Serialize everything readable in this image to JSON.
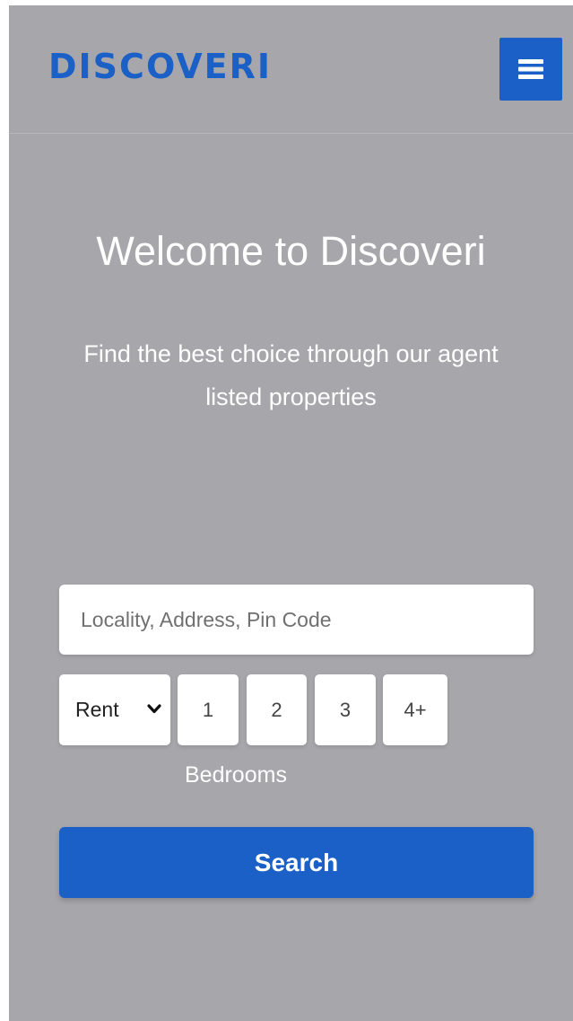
{
  "header": {
    "logo_text": "DISCOVERI",
    "menu_icon": "hamburger-menu-icon"
  },
  "hero": {
    "title": "Welcome to Discoveri",
    "subtitle_line1": "Find the best choice through our agent",
    "subtitle_line2": "listed properties"
  },
  "search": {
    "placeholder": "Locality, Address, Pin Code",
    "value": "",
    "listing_type": {
      "selected": "Rent",
      "icon": "chevron-down-icon"
    },
    "bedroom_options": [
      "1",
      "2",
      "3",
      "4+"
    ],
    "bedrooms_label": "Bedrooms",
    "submit_label": "Search"
  },
  "colors": {
    "brand_blue": "#1a60c7",
    "overlay_gray": "#a7a6ab",
    "text_white": "#ffffff"
  }
}
